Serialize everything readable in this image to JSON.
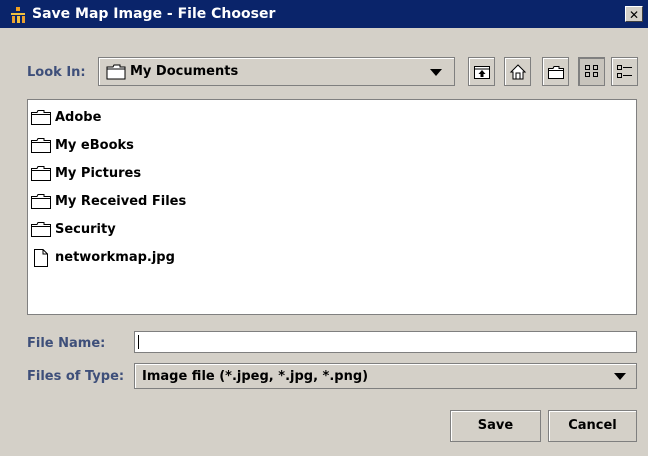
{
  "window": {
    "title": "Save Map Image - File Chooser",
    "close_glyph": "✕",
    "icon": "java-app-icon"
  },
  "toolbar": {
    "look_in_label": "Look In:",
    "look_in_value": "My Documents",
    "buttons": [
      "up-one-level-icon",
      "home-icon",
      "new-folder-icon",
      "list-view-icon",
      "details-view-icon"
    ]
  },
  "files": [
    {
      "name": "Adobe",
      "type": "folder"
    },
    {
      "name": "My eBooks",
      "type": "folder"
    },
    {
      "name": "My Pictures",
      "type": "folder"
    },
    {
      "name": "My Received Files",
      "type": "folder"
    },
    {
      "name": "Security",
      "type": "folder"
    },
    {
      "name": "networkmap.jpg",
      "type": "file"
    }
  ],
  "form": {
    "file_name_label": "File Name:",
    "file_name_value": "",
    "files_of_type_label": "Files of Type:",
    "files_of_type_value": "Image file (*.jpeg, *.jpg, *.png)"
  },
  "actions": {
    "save_label": "Save",
    "cancel_label": "Cancel"
  }
}
